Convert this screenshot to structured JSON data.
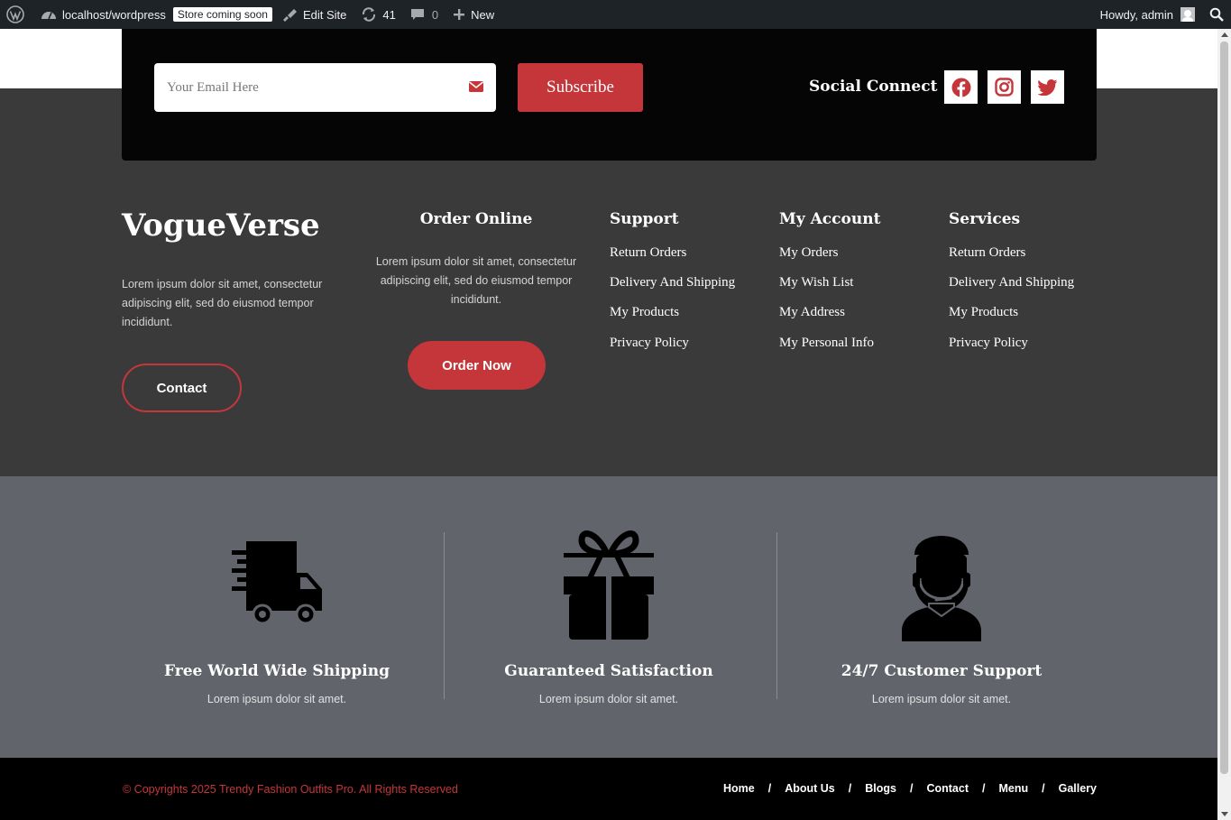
{
  "admin_bar": {
    "site_name": "localhost/wordpress",
    "store_badge": "Store coming soon",
    "edit_site": "Edit Site",
    "updates_count": "41",
    "comments_count": "0",
    "new_label": "New",
    "howdy": "Howdy, admin"
  },
  "newsletter": {
    "email_placeholder": "Your Email Here",
    "email_value": "",
    "subscribe_label": "Subscribe",
    "social_title": "Social Connect",
    "social_icons": [
      "facebook-icon",
      "instagram-icon",
      "twitter-icon"
    ]
  },
  "footer": {
    "brand": "VogueVerse",
    "brand_desc": "Lorem ipsum dolor sit amet, consectetur adipiscing elit, sed do eiusmod tempor incididunt.",
    "contact_label": "Contact",
    "order_title": "Order Online",
    "order_desc": "Lorem ipsum dolor sit amet, consectetur adipiscing elit, sed do eiusmod tempor incididunt.",
    "order_label": "Order Now",
    "columns": [
      {
        "title": "Support",
        "links": [
          "Return Orders",
          "Delivery And Shipping",
          "My Products",
          "Privacy Policy"
        ]
      },
      {
        "title": "My Account",
        "links": [
          "My Orders",
          "My Wish List",
          "My Address",
          "My Personal Info"
        ]
      },
      {
        "title": "Services",
        "links": [
          "Return Orders",
          "Delivery And Shipping",
          "My Products",
          "Privacy Policy"
        ]
      }
    ]
  },
  "features": [
    {
      "icon": "shipping-truck-icon",
      "title": "Free World Wide Shipping",
      "desc": "Lorem ipsum dolor sit amet."
    },
    {
      "icon": "gift-icon",
      "title": "Guaranteed Satisfaction",
      "desc": "Lorem ipsum dolor sit amet."
    },
    {
      "icon": "customer-support-icon",
      "title": "24/7 Customer Support",
      "desc": "Lorem ipsum dolor sit amet."
    }
  ],
  "bottom": {
    "copyright": "© Copyrights 2025 Trendy Fashion Outfits Pro. All Rights Reserved",
    "nav": [
      "Home",
      "About Us",
      "Blogs",
      "Contact",
      "Menu",
      "Gallery"
    ],
    "separator": "/"
  },
  "colors": {
    "accent": "#c4363a",
    "footer_bg": "#3a3a3a",
    "feature_bg": "#62646c",
    "bar_bg": "#000000",
    "admin_bar_bg": "#1d2327"
  }
}
